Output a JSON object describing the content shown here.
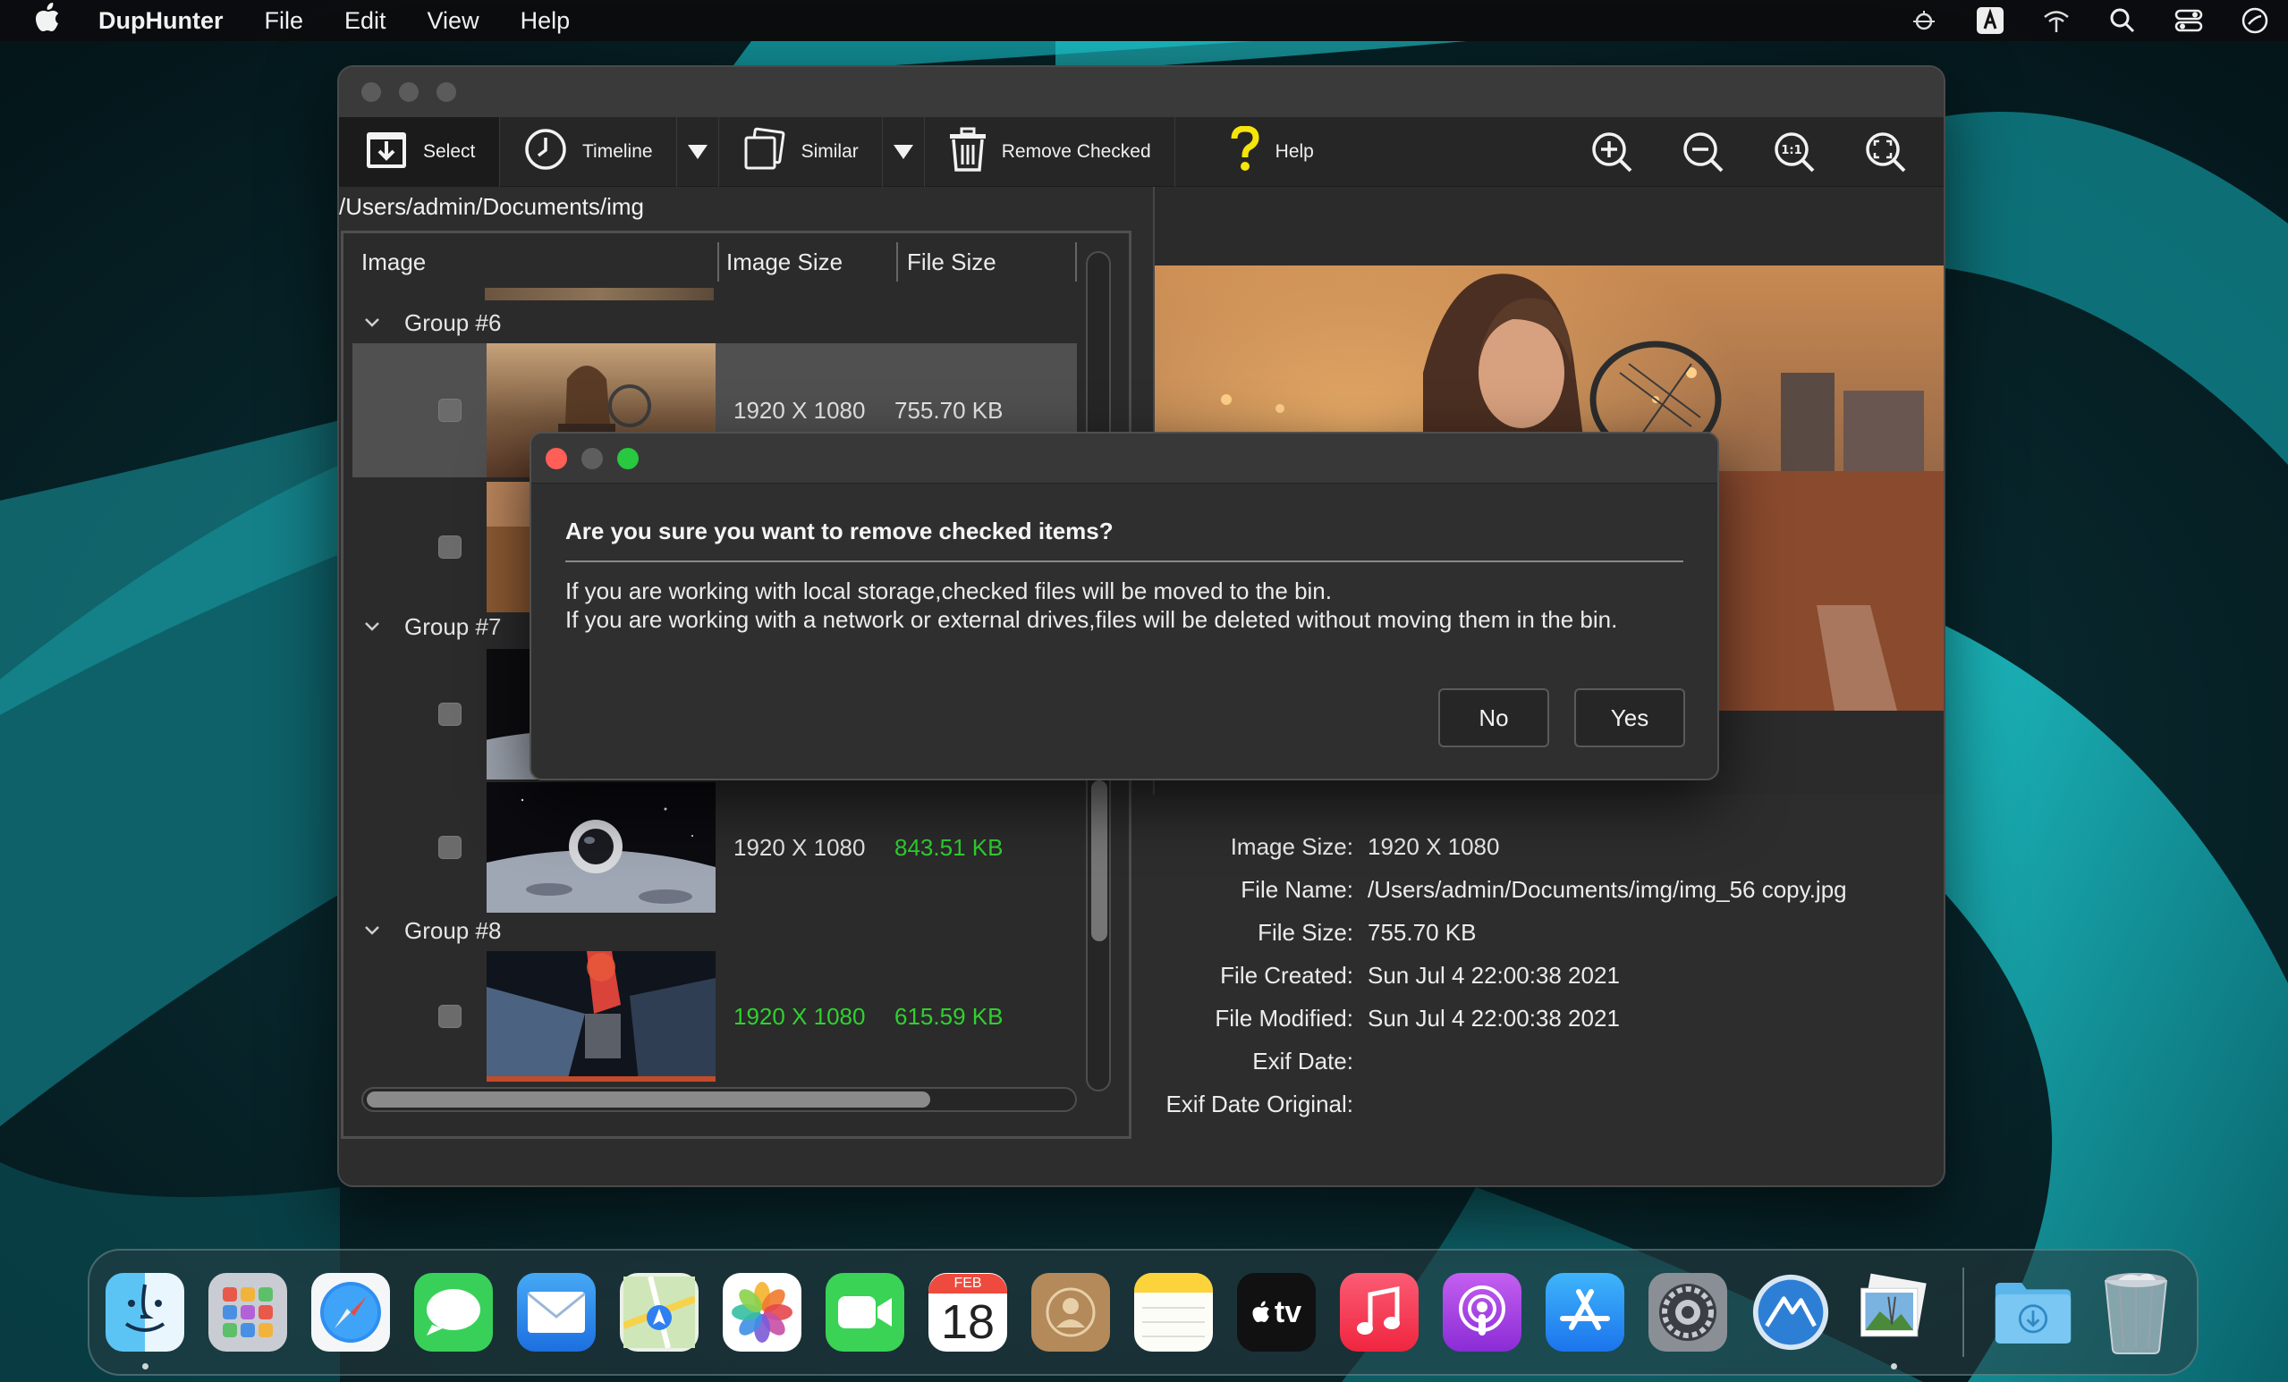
{
  "menubar": {
    "app_name": "DupHunter",
    "menus": [
      "File",
      "Edit",
      "View",
      "Help"
    ]
  },
  "toolbar": {
    "select_label": "Select",
    "timeline_label": "Timeline",
    "similar_label": "Similar",
    "remove_label": "Remove Checked",
    "help_label": "Help"
  },
  "path": "/Users/admin/Documents/img",
  "list": {
    "columns": [
      "Image",
      "Image Size",
      "File Size"
    ],
    "groups": [
      {
        "label": "Group #6"
      },
      {
        "label": "Group #7"
      },
      {
        "label": "Group #8"
      }
    ],
    "rows": [
      {
        "image_size": "1920 X 1080",
        "file_size": "755.70 KB"
      },
      {
        "image_size": "1920 X 1080",
        "file_size": "843.51 KB"
      },
      {
        "image_size": "1920 X 1080",
        "file_size": "615.59 KB"
      }
    ]
  },
  "info": {
    "labels": {
      "image_size": "Image Size:",
      "file_name": "File Name:",
      "file_size": "File Size:",
      "file_created": "File Created:",
      "file_modified": "File Modified:",
      "exif_date": "Exif Date:",
      "exif_date_original": "Exif Date Original:"
    },
    "values": {
      "image_size": "1920 X 1080",
      "file_name": "/Users/admin/Documents/img/img_56 copy.jpg",
      "file_size": "755.70 KB",
      "file_created": "Sun Jul 4 22:00:38 2021",
      "file_modified": "Sun Jul 4 22:00:38 2021",
      "exif_date": "",
      "exif_date_original": ""
    }
  },
  "dialog": {
    "question": "Are you sure you want to remove checked items?",
    "line1": "If you are working with local storage,checked files will be moved to the bin.",
    "line2": "If you are working with a network or external drives,files will be deleted without moving them in the bin.",
    "no_label": "No",
    "yes_label": "Yes"
  },
  "dock": {
    "calendar_month": "FEB",
    "calendar_day": "18",
    "tv_label": "tv"
  },
  "colors": {
    "highlight_green": "#2fd12f",
    "close_red": "#ff5f57",
    "zoom_green": "#28c840",
    "help_yellow": "#f5e50a"
  }
}
